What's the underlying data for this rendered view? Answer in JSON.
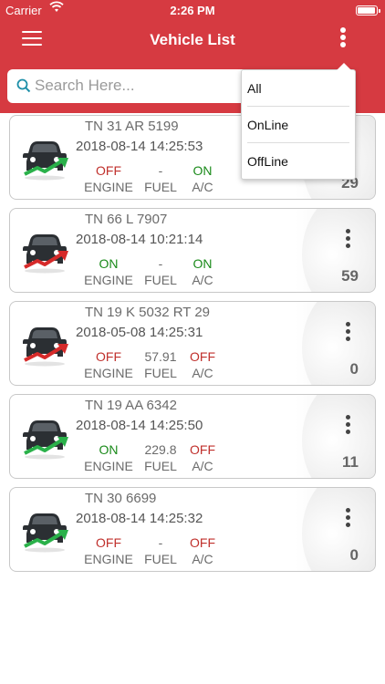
{
  "status_bar": {
    "carrier": "Carrier",
    "time": "2:26 PM"
  },
  "header": {
    "title": "Vehicle List"
  },
  "search": {
    "placeholder": "Search Here..."
  },
  "filter_menu": {
    "options": [
      "All",
      "OnLine",
      "OffLine"
    ]
  },
  "labels": {
    "engine": "ENGINE",
    "fuel": "FUEL",
    "ac": "A/C"
  },
  "colors": {
    "primary": "#d63a41",
    "on": "#1a8a1a",
    "off": "#c0302c"
  },
  "vehicles": [
    {
      "number": "TN 31 AR 5199",
      "timestamp": "2018-08-14 14:25:53",
      "engine": "OFF",
      "fuel": "-",
      "ac": "ON",
      "count": "29",
      "trend": "green"
    },
    {
      "number": "TN 66 L 7907",
      "timestamp": "2018-08-14 10:21:14",
      "engine": "ON",
      "fuel": "-",
      "ac": "ON",
      "count": "59",
      "trend": "red"
    },
    {
      "number": "TN 19 K 5032 RT 29",
      "timestamp": "2018-05-08 14:25:31",
      "engine": "OFF",
      "fuel": "57.91",
      "ac": "OFF",
      "count": "0",
      "trend": "red"
    },
    {
      "number": "TN 19 AA 6342",
      "timestamp": "2018-08-14 14:25:50",
      "engine": "ON",
      "fuel": "229.8",
      "ac": "OFF",
      "count": "11",
      "trend": "green"
    },
    {
      "number": "TN 30 6699",
      "timestamp": "2018-08-14 14:25:32",
      "engine": "OFF",
      "fuel": "-",
      "ac": "OFF",
      "count": "0",
      "trend": "green"
    }
  ]
}
